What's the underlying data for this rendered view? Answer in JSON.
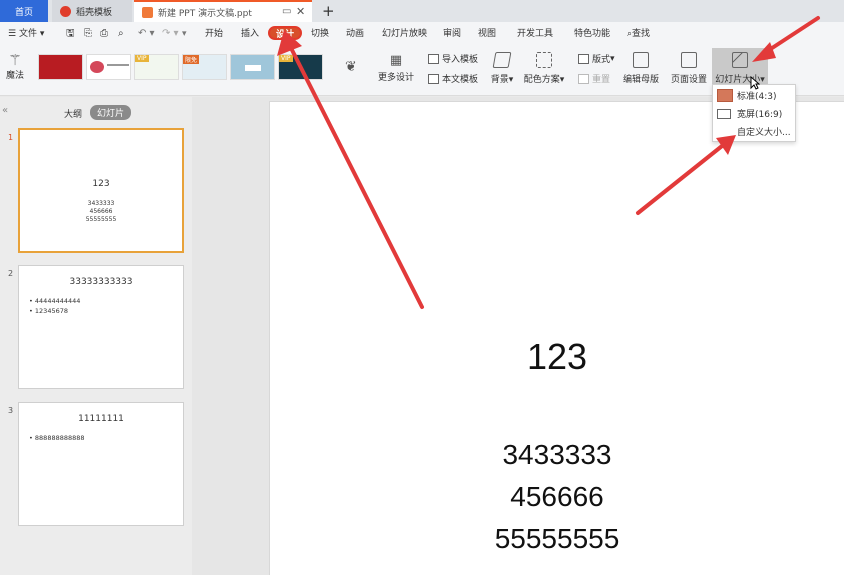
{
  "tabs": {
    "home": "首页",
    "template": "稻壳模板",
    "document": "新建 PPT 演示文稿.ppt"
  },
  "menubar": {
    "file": "文件",
    "items": [
      "开始",
      "插入",
      "设计",
      "切换",
      "动画",
      "幻灯片放映",
      "审阅",
      "视图",
      "开发工具",
      "特色功能"
    ],
    "search": "查找"
  },
  "ribbon": {
    "magic": "魔法",
    "more_design": "更多设计",
    "import_template": "导入模板",
    "this_template": "本文模板",
    "background": "背景",
    "color_scheme": "配色方案",
    "layout": "版式",
    "reset": "重置",
    "edit_master": "编辑母版",
    "page_setup": "页面设置",
    "slide_size": "幻灯片大小",
    "badge_vip": "VIP",
    "badge_free": "限免"
  },
  "leftpane": {
    "outline": "大纲",
    "slides_tab": "幻灯片"
  },
  "slides": [
    {
      "num": "1",
      "title": "123",
      "lines": [
        "3433333",
        "456666",
        "55555555"
      ]
    },
    {
      "num": "2",
      "title": "33333333333",
      "bullets": [
        "44444444444",
        "12345678"
      ]
    },
    {
      "num": "3",
      "title": "11111111",
      "bullets": [
        "888888888888"
      ]
    }
  ],
  "canvas": {
    "title": "123",
    "lines": [
      "3433333",
      "456666",
      "55555555"
    ]
  },
  "dropdown": {
    "standard": "标准(4:3)",
    "wide": "宽屏(16:9)",
    "custom": "自定义大小..."
  },
  "colors": {
    "accent": "#2f6ad9",
    "design_tab": "#d84f2a",
    "arrow": "#e23a3a",
    "selection": "#e8a23a"
  }
}
